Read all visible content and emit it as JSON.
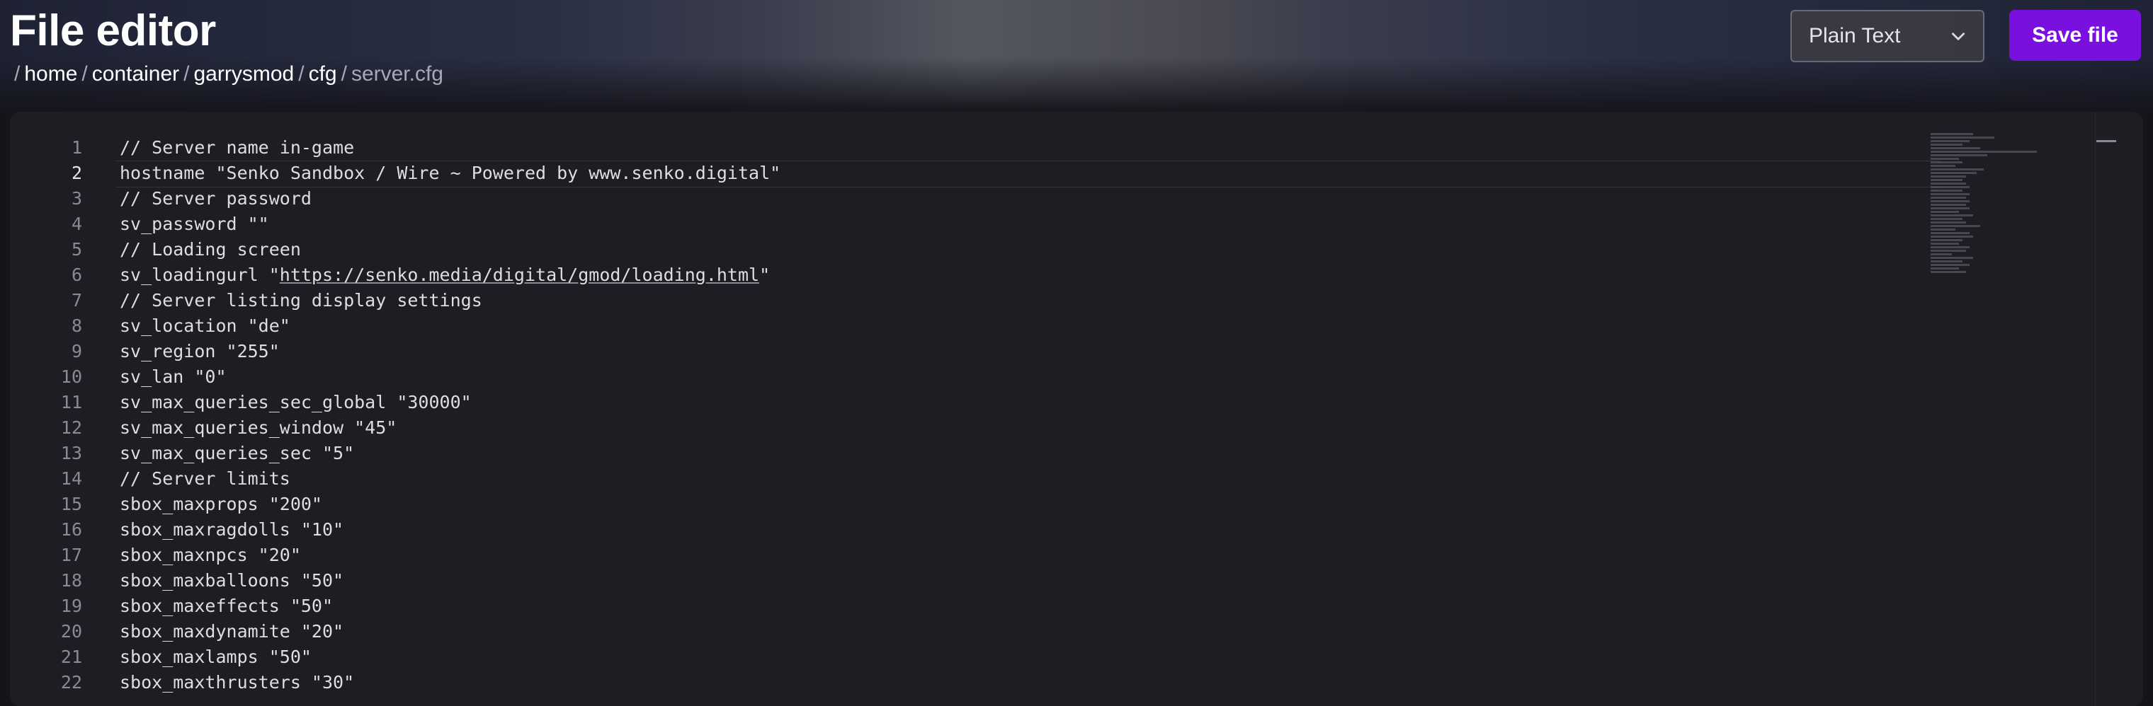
{
  "header": {
    "title": "File editor",
    "breadcrumb": {
      "leading_sep": "/",
      "items": [
        {
          "label": "home",
          "current": false
        },
        {
          "label": "container",
          "current": false
        },
        {
          "label": "garrysmod",
          "current": false
        },
        {
          "label": "cfg",
          "current": false
        },
        {
          "label": "server.cfg",
          "current": true
        }
      ]
    },
    "mode_select": {
      "value": "Plain Text",
      "icon": "chevron-down-icon"
    },
    "save_label": "Save file"
  },
  "colors": {
    "accent": "#7a10e0",
    "background": "#15141b",
    "editor_bg": "#1f1d24"
  },
  "editor": {
    "active_line": 2,
    "lines": [
      {
        "n": "1",
        "text": "// Server name in-game"
      },
      {
        "n": "2",
        "text": "hostname \"Senko Sandbox / Wire ~ Powered by www.senko.digital\""
      },
      {
        "n": "3",
        "text": "// Server password"
      },
      {
        "n": "4",
        "text": "sv_password \"\""
      },
      {
        "n": "5",
        "text": "// Loading screen"
      },
      {
        "n": "6",
        "text": "sv_loadingurl \"https://senko.media/digital/gmod/loading.html\"",
        "link": "https://senko.media/digital/gmod/loading.html"
      },
      {
        "n": "7",
        "text": "// Server listing display settings"
      },
      {
        "n": "8",
        "text": "sv_location \"de\""
      },
      {
        "n": "9",
        "text": "sv_region \"255\""
      },
      {
        "n": "10",
        "text": "sv_lan \"0\""
      },
      {
        "n": "11",
        "text": "sv_max_queries_sec_global \"30000\""
      },
      {
        "n": "12",
        "text": "sv_max_queries_window \"45\""
      },
      {
        "n": "13",
        "text": "sv_max_queries_sec \"5\""
      },
      {
        "n": "14",
        "text": "// Server limits"
      },
      {
        "n": "15",
        "text": "sbox_maxprops \"200\""
      },
      {
        "n": "16",
        "text": "sbox_maxragdolls \"10\""
      },
      {
        "n": "17",
        "text": "sbox_maxnpcs \"20\""
      },
      {
        "n": "18",
        "text": "sbox_maxballoons \"50\""
      },
      {
        "n": "19",
        "text": "sbox_maxeffects \"50\""
      },
      {
        "n": "20",
        "text": "sbox_maxdynamite \"20\""
      },
      {
        "n": "21",
        "text": "sbox_maxlamps \"50\""
      },
      {
        "n": "22",
        "text": "sbox_maxthrusters \"30\""
      }
    ]
  }
}
